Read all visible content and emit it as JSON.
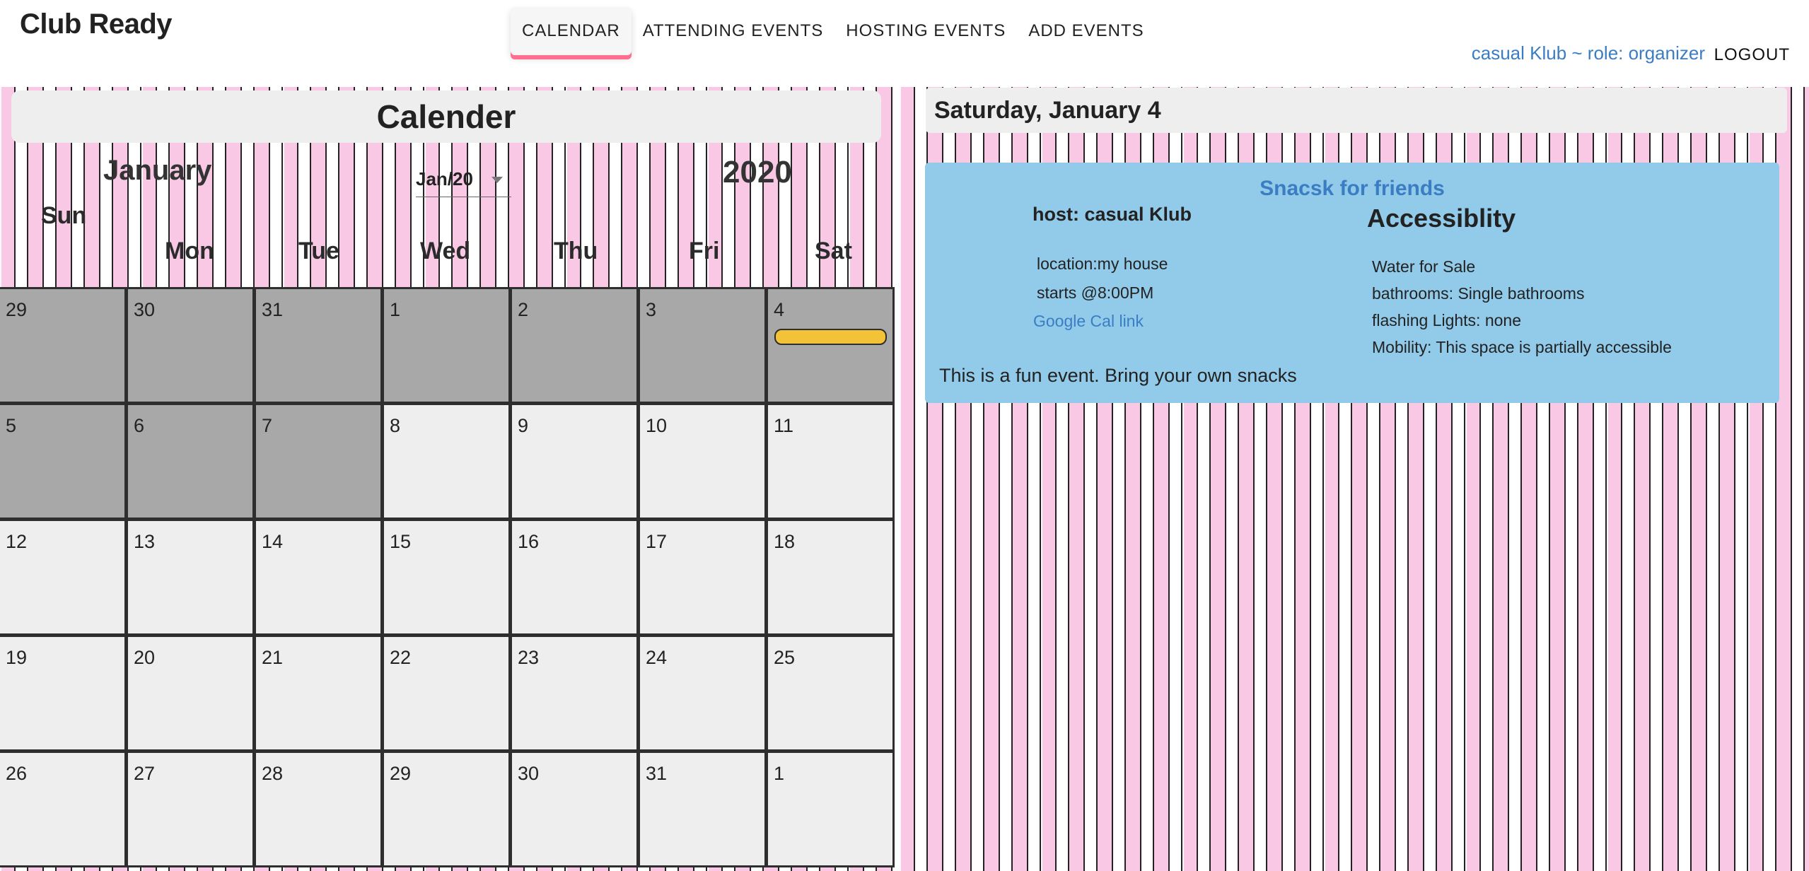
{
  "app": {
    "brand": "Club Ready"
  },
  "nav": {
    "items": [
      {
        "label": "CALENDAR",
        "active": true
      },
      {
        "label": "ATTENDING EVENTS",
        "active": false
      },
      {
        "label": "HOSTING EVENTS",
        "active": false
      },
      {
        "label": "ADD EVENTS",
        "active": false
      }
    ],
    "user_info": "casual Klub ~ role: organizer",
    "logout_label": "LOGOUT"
  },
  "calendar": {
    "title": "Calender",
    "month": "January",
    "selected_month": "Jan/20",
    "year": "2020",
    "weekdays": [
      "Sun",
      "Mon",
      "Tue",
      "Wed",
      "Thu",
      "Fri",
      "Sat"
    ],
    "weeks": [
      [
        {
          "day": "29",
          "past": true
        },
        {
          "day": "30",
          "past": true
        },
        {
          "day": "31",
          "past": true
        },
        {
          "day": "1",
          "past": true
        },
        {
          "day": "2",
          "past": true
        },
        {
          "day": "3",
          "past": true
        },
        {
          "day": "4",
          "past": true,
          "has_event": true
        }
      ],
      [
        {
          "day": "5",
          "past": true
        },
        {
          "day": "6",
          "past": true
        },
        {
          "day": "7",
          "past": true
        },
        {
          "day": "8",
          "past": false
        },
        {
          "day": "9",
          "past": false
        },
        {
          "day": "10",
          "past": false
        },
        {
          "day": "11",
          "past": false
        }
      ],
      [
        {
          "day": "12",
          "past": false
        },
        {
          "day": "13",
          "past": false
        },
        {
          "day": "14",
          "past": false
        },
        {
          "day": "15",
          "past": false
        },
        {
          "day": "16",
          "past": false
        },
        {
          "day": "17",
          "past": false
        },
        {
          "day": "18",
          "past": false
        }
      ],
      [
        {
          "day": "19",
          "past": false
        },
        {
          "day": "20",
          "past": false
        },
        {
          "day": "21",
          "past": false
        },
        {
          "day": "22",
          "past": false
        },
        {
          "day": "23",
          "past": false
        },
        {
          "day": "24",
          "past": false
        },
        {
          "day": "25",
          "past": false
        }
      ],
      [
        {
          "day": "26",
          "past": false
        },
        {
          "day": "27",
          "past": false
        },
        {
          "day": "28",
          "past": false
        },
        {
          "day": "29",
          "past": false
        },
        {
          "day": "30",
          "past": false
        },
        {
          "day": "31",
          "past": false
        },
        {
          "day": "1",
          "past": false
        }
      ]
    ],
    "colors": {
      "past": "#a8a8a8",
      "future": "#eeeeee",
      "event": "#f4c237"
    }
  },
  "detail": {
    "date_header": "Saturday, January 4",
    "event": {
      "name": "Snacsk for friends",
      "host": "host: casual Klub",
      "location": "location:my house",
      "starts": "starts @8:00PM",
      "calendar_link": "Google Cal link",
      "description": "This is a fun event. Bring your own snacks",
      "accessibility_title": "Accessiblity",
      "accessibility": [
        "Water for Sale",
        "bathrooms: Single bathrooms",
        "flashing Lights: none",
        "Mobility: This space is partially accessible"
      ]
    }
  },
  "colors": {
    "accent": "#3b7dc3",
    "nav_underline": "#ff6e8f",
    "card": "#92cbe9",
    "background_pink": "#f8c8e4"
  }
}
